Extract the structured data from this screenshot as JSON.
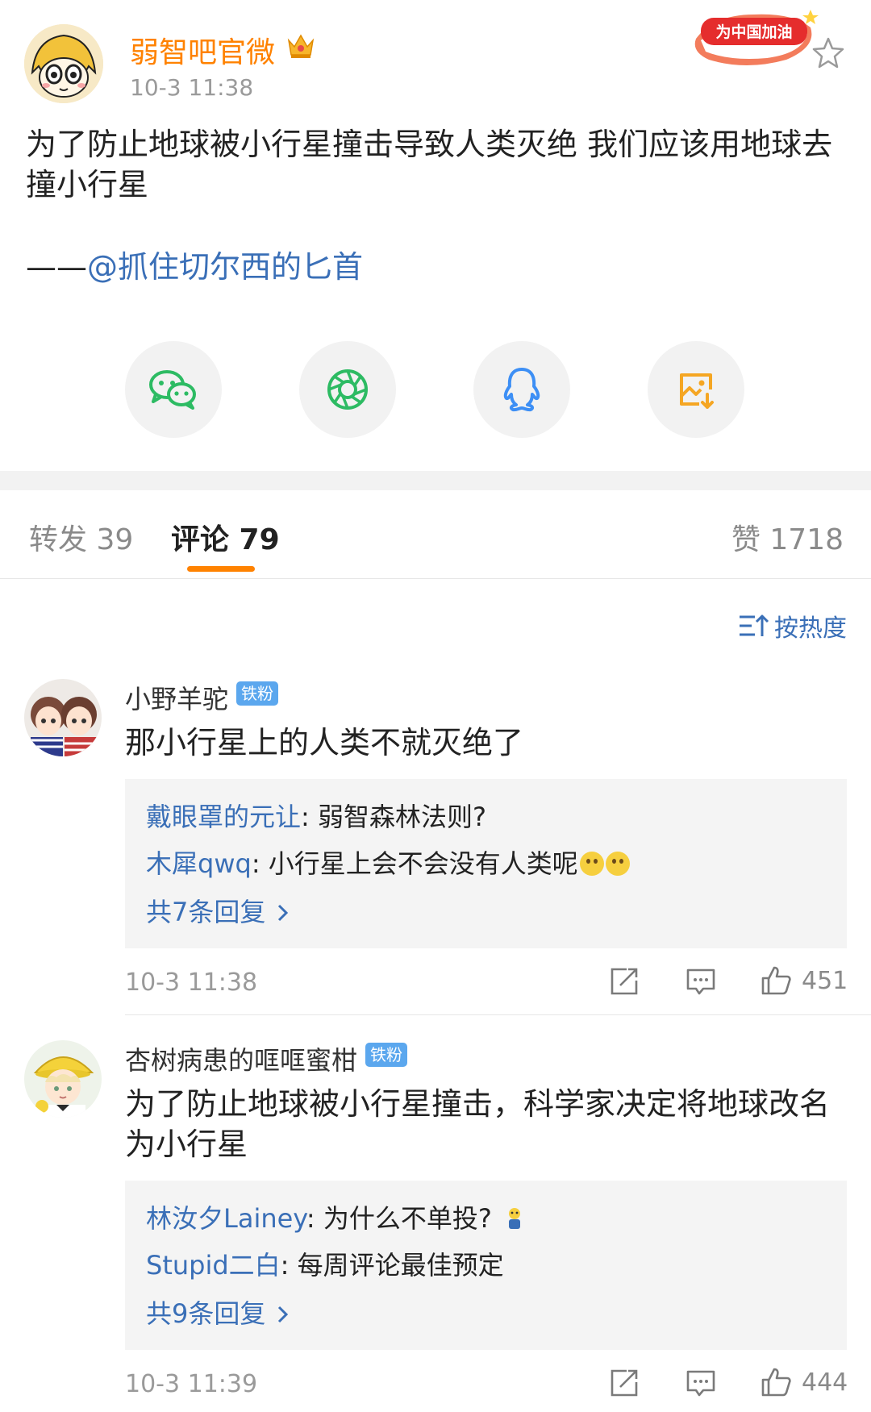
{
  "post": {
    "author": "弱智吧官微",
    "time": "10-3 11:38",
    "banner_text": "为中国加油",
    "text": "为了防止地球被小行星撞击导致人类灭绝 我们应该用地球去撞小行星",
    "sign_prefix": "——",
    "sign_mention": "@抓住切尔西的匕首"
  },
  "share": [
    {
      "name": "wechat-icon",
      "color": "#2dbb63"
    },
    {
      "name": "moments-icon",
      "color": "#2dbb63"
    },
    {
      "name": "qq-icon",
      "color": "#3d8ff5"
    },
    {
      "name": "save-image-icon",
      "color": "#f5a623"
    }
  ],
  "tabs": {
    "repost": "转发 39",
    "comment": "评论 79",
    "like": "赞 1718"
  },
  "sort_label": "按热度",
  "colors": {
    "accent": "#ff8200",
    "link": "#3a6fb7",
    "fan_badge": "#5ba7ee"
  },
  "comments": [
    {
      "name": "小野羊驼",
      "badge": "铁粉",
      "text": "那小行星上的人类不就灭绝了",
      "replies": [
        {
          "name": "戴眼罩的元让",
          "text": ": 弱智森林法则?"
        },
        {
          "name": "木犀qwq",
          "text": ": 小行星上会不会没有人类呢"
        }
      ],
      "more": "共7条回复",
      "time": "10-3 11:38",
      "likes": "451"
    },
    {
      "name": "杏树病患的哐哐蜜柑",
      "badge": "铁粉",
      "text": "为了防止地球被小行星撞击，科学家决定将地球改名为小行星",
      "replies": [
        {
          "name": "林汝夕Lainey",
          "text": ": 为什么不单投?"
        },
        {
          "name": "Stupid二白",
          "text": ": 每周评论最佳预定"
        }
      ],
      "more": "共9条回复",
      "time": "10-3 11:39",
      "likes": "444"
    }
  ]
}
